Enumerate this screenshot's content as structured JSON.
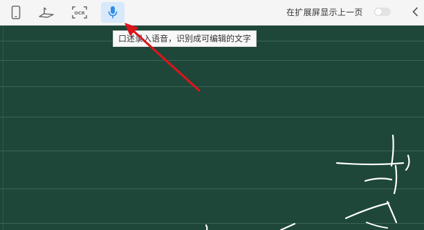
{
  "toolbar": {
    "tools": [
      {
        "id": "phone",
        "icon": "phone-icon",
        "active": false
      },
      {
        "id": "projector",
        "icon": "projector-icon",
        "active": false
      },
      {
        "id": "ocr",
        "icon": "ocr-icon",
        "label": "OCR",
        "active": false
      },
      {
        "id": "voice",
        "icon": "microphone-icon",
        "active": true
      }
    ],
    "extend_screen_label": "在扩展屏显示上一页",
    "extend_screen_toggle": false,
    "collapse_icon": "chevron-left-icon"
  },
  "tooltip": {
    "text": "口述录入语音，识别成可编辑的文字"
  },
  "board": {
    "background_color": "#1e4739",
    "line_color": "#3b6356",
    "stroke_color": "#ffffff"
  },
  "annotation": {
    "arrow_color": "#d9161c"
  },
  "colors": {
    "toolbar_bg": "#f5f5f5",
    "active_tool_bg": "#d7e9fb",
    "mic_blue": "#2f8de4"
  }
}
